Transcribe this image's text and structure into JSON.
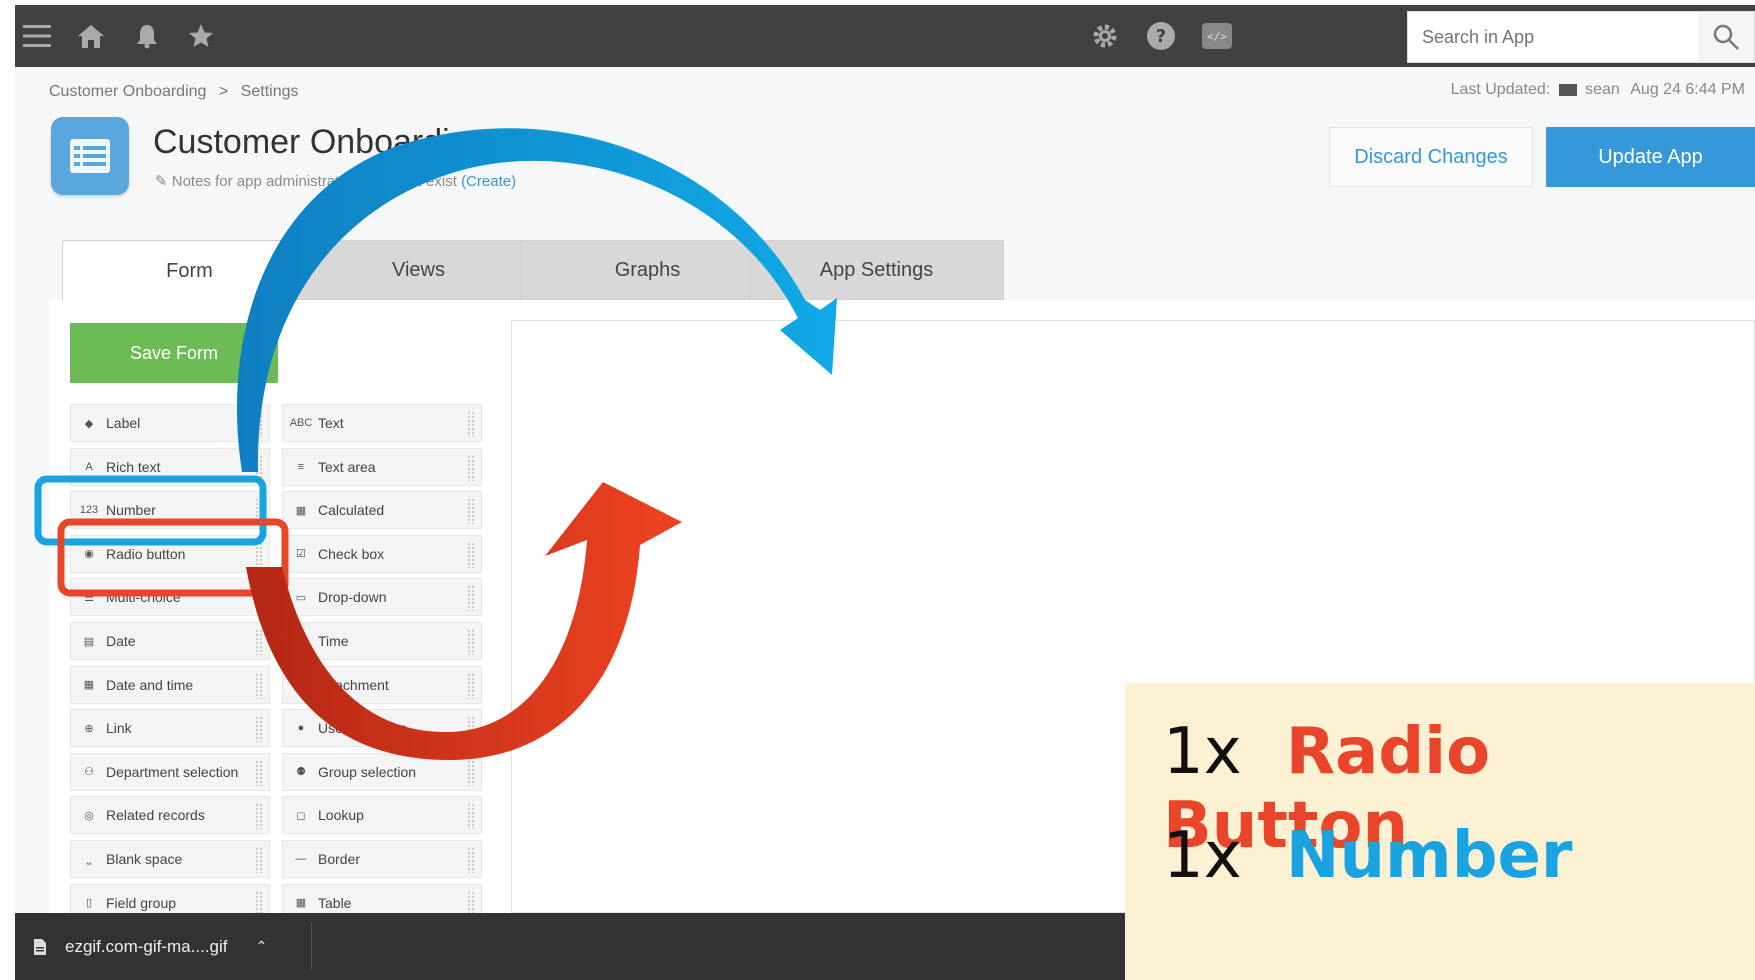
{
  "topbar": {
    "icons": [
      "menu-icon",
      "home-icon",
      "bell-icon",
      "star-icon",
      "gear-icon",
      "help-icon",
      "code-icon",
      "search-icon"
    ],
    "search_placeholder": "Search in App"
  },
  "breadcrumb": {
    "items": [
      "Customer Onboarding",
      "Settings"
    ],
    "separator": ">"
  },
  "last_updated": {
    "label": "Last Updated:",
    "user": "sean",
    "time": "Aug 24 6:44 PM"
  },
  "app": {
    "title": "Customer Onboarding",
    "notes_text": "Notes for app administrators does not exist",
    "notes_link": "(Create)"
  },
  "actions": {
    "discard": "Discard Changes",
    "update": "Update App"
  },
  "tabs": [
    "Form",
    "Views",
    "Graphs",
    "App Settings"
  ],
  "form": {
    "save_label": "Save Form",
    "fields_left": [
      "Label",
      "Rich text",
      "Number",
      "Radio button",
      "Multi-choice",
      "Date",
      "Date and time",
      "Link",
      "Department selection",
      "Related records",
      "Blank space",
      "Field group"
    ],
    "fields_right": [
      "Text",
      "Text area",
      "Calculated",
      "Check box",
      "Drop-down",
      "Time",
      "Attachment",
      "User selection",
      "Group selection",
      "Lookup",
      "Border",
      "Table"
    ]
  },
  "download": {
    "filename": "ezgif.com-gif-ma....gif"
  },
  "callout": {
    "line1_count": "1x",
    "line1_label": "Radio Button",
    "line2_count": "1x",
    "line2_label": "Number"
  },
  "colors": {
    "topbar": "#414141",
    "accent_blue": "#3498db",
    "save_green": "#6dbb54",
    "highlight_red": "#e8452a",
    "highlight_blue": "#19a3e0",
    "callout_bg": "#fdf1d4"
  }
}
